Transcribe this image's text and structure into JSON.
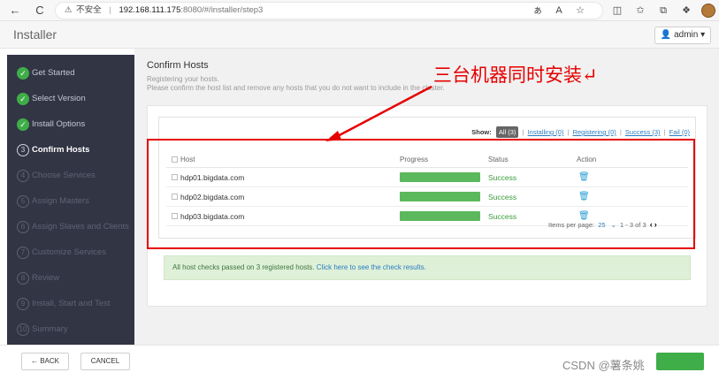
{
  "browser": {
    "back": "←",
    "reload": "C",
    "insecure_label": "不安全",
    "url_host": "192.168.111.175",
    "url_path": ":8080/#/installer/step3"
  },
  "header": {
    "title": "Installer",
    "user_label": "admin"
  },
  "sidebar": {
    "steps": [
      {
        "num": "1",
        "label": "Get Started",
        "state": "done"
      },
      {
        "num": "2",
        "label": "Select Version",
        "state": "done"
      },
      {
        "num": "3",
        "label": "Install Options",
        "state": "done"
      },
      {
        "num": "3",
        "label": "Confirm Hosts",
        "state": "current"
      },
      {
        "num": "4",
        "label": "Choose Services",
        "state": "todo"
      },
      {
        "num": "5",
        "label": "Assign Masters",
        "state": "todo"
      },
      {
        "num": "6",
        "label": "Assign Slaves and Clients",
        "state": "todo"
      },
      {
        "num": "7",
        "label": "Customize Services",
        "state": "todo"
      },
      {
        "num": "8",
        "label": "Review",
        "state": "todo"
      },
      {
        "num": "9",
        "label": "Install, Start and Test",
        "state": "todo"
      },
      {
        "num": "10",
        "label": "Summary",
        "state": "todo"
      }
    ]
  },
  "main": {
    "title": "Confirm Hosts",
    "subtitle_1": "Registering your hosts.",
    "subtitle_2": "Please confirm the host list and remove any hosts that you do not want to include in the cluster.",
    "annotation": "三台机器同时安装↵",
    "filter": {
      "show_label": "Show:",
      "all": "All (3)",
      "installing": "Installing (0)",
      "registering": "Registering (0)",
      "success": "Success (3)",
      "fail": "Fail (0)"
    },
    "table": {
      "headers": {
        "host": "Host",
        "progress": "Progress",
        "status": "Status",
        "action": "Action"
      },
      "rows": [
        {
          "host": "hdp01.bigdata.com",
          "progress": 1.0,
          "status": "Success"
        },
        {
          "host": "hdp02.bigdata.com",
          "progress": 1.0,
          "status": "Success"
        },
        {
          "host": "hdp03.bigdata.com",
          "progress": 1.0,
          "status": "Success"
        }
      ]
    },
    "pager": {
      "items_label": "Items per page:",
      "per_page": "25",
      "range": "1 - 3 of 3"
    },
    "success_message": "All host checks passed on 3 registered hosts.",
    "success_link": "Click here to see the check results."
  },
  "footer": {
    "back_label": "← BACK",
    "cancel_label": "CANCEL",
    "watermark": "CSDN @薯条姚"
  },
  "colors": {
    "sidebar_bg": "#323544",
    "done_green": "#3fae49",
    "progress_green": "#5cb85c",
    "link_blue": "#2a7dc0",
    "annotation_red": "#e60000"
  }
}
